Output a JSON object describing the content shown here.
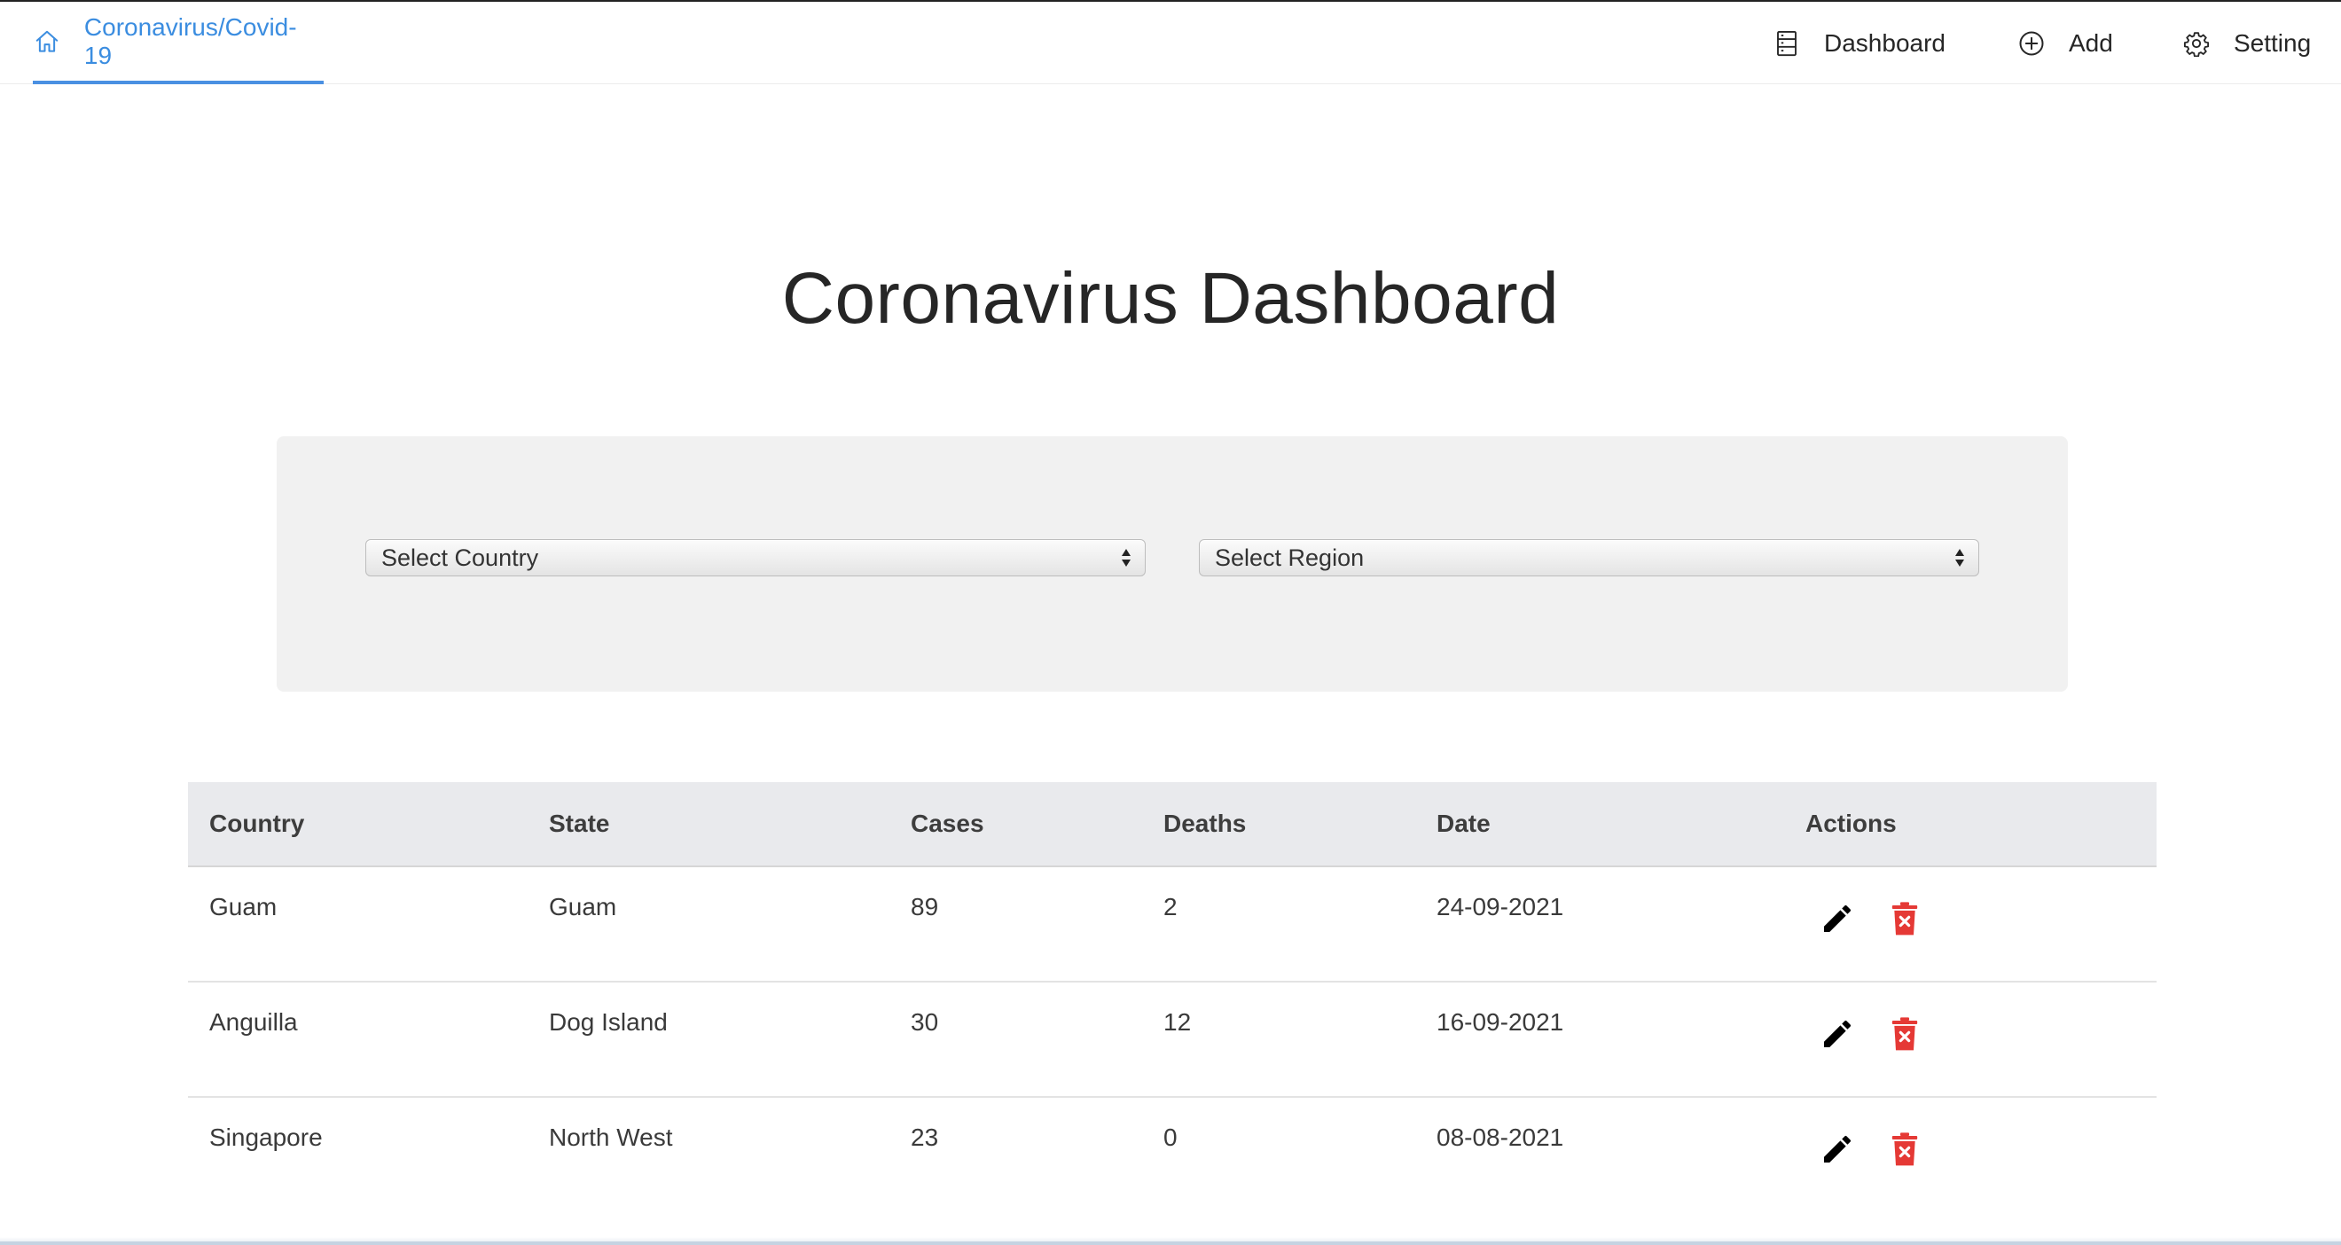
{
  "navbar": {
    "brand_label": "Coronavirus/Covid-19",
    "brand_icon": "home-icon",
    "items": [
      {
        "label": "Dashboard",
        "icon": "dashboard-icon"
      },
      {
        "label": "Add",
        "icon": "add-circle-icon"
      },
      {
        "label": "Setting",
        "icon": "gear-icon"
      }
    ]
  },
  "page": {
    "title": "Coronavirus Dashboard"
  },
  "filters": {
    "country_select": "Select Country",
    "region_select": "Select Region"
  },
  "table": {
    "columns": [
      "Country",
      "State",
      "Cases",
      "Deaths",
      "Date",
      "Actions"
    ],
    "rows": [
      {
        "country": "Guam",
        "state": "Guam",
        "cases": "89",
        "deaths": "2",
        "date": "24-09-2021"
      },
      {
        "country": "Anguilla",
        "state": "Dog Island",
        "cases": "30",
        "deaths": "12",
        "date": "16-09-2021"
      },
      {
        "country": "Singapore",
        "state": "North West",
        "cases": "23",
        "deaths": "0",
        "date": "08-08-2021"
      }
    ],
    "action_icons": [
      "edit-pencil-icon",
      "delete-trash-icon"
    ]
  },
  "colors": {
    "accent": "#3b8de0",
    "delete": "#e53935",
    "panel": "#f1f1f1",
    "table_header": "#e9eaed"
  }
}
